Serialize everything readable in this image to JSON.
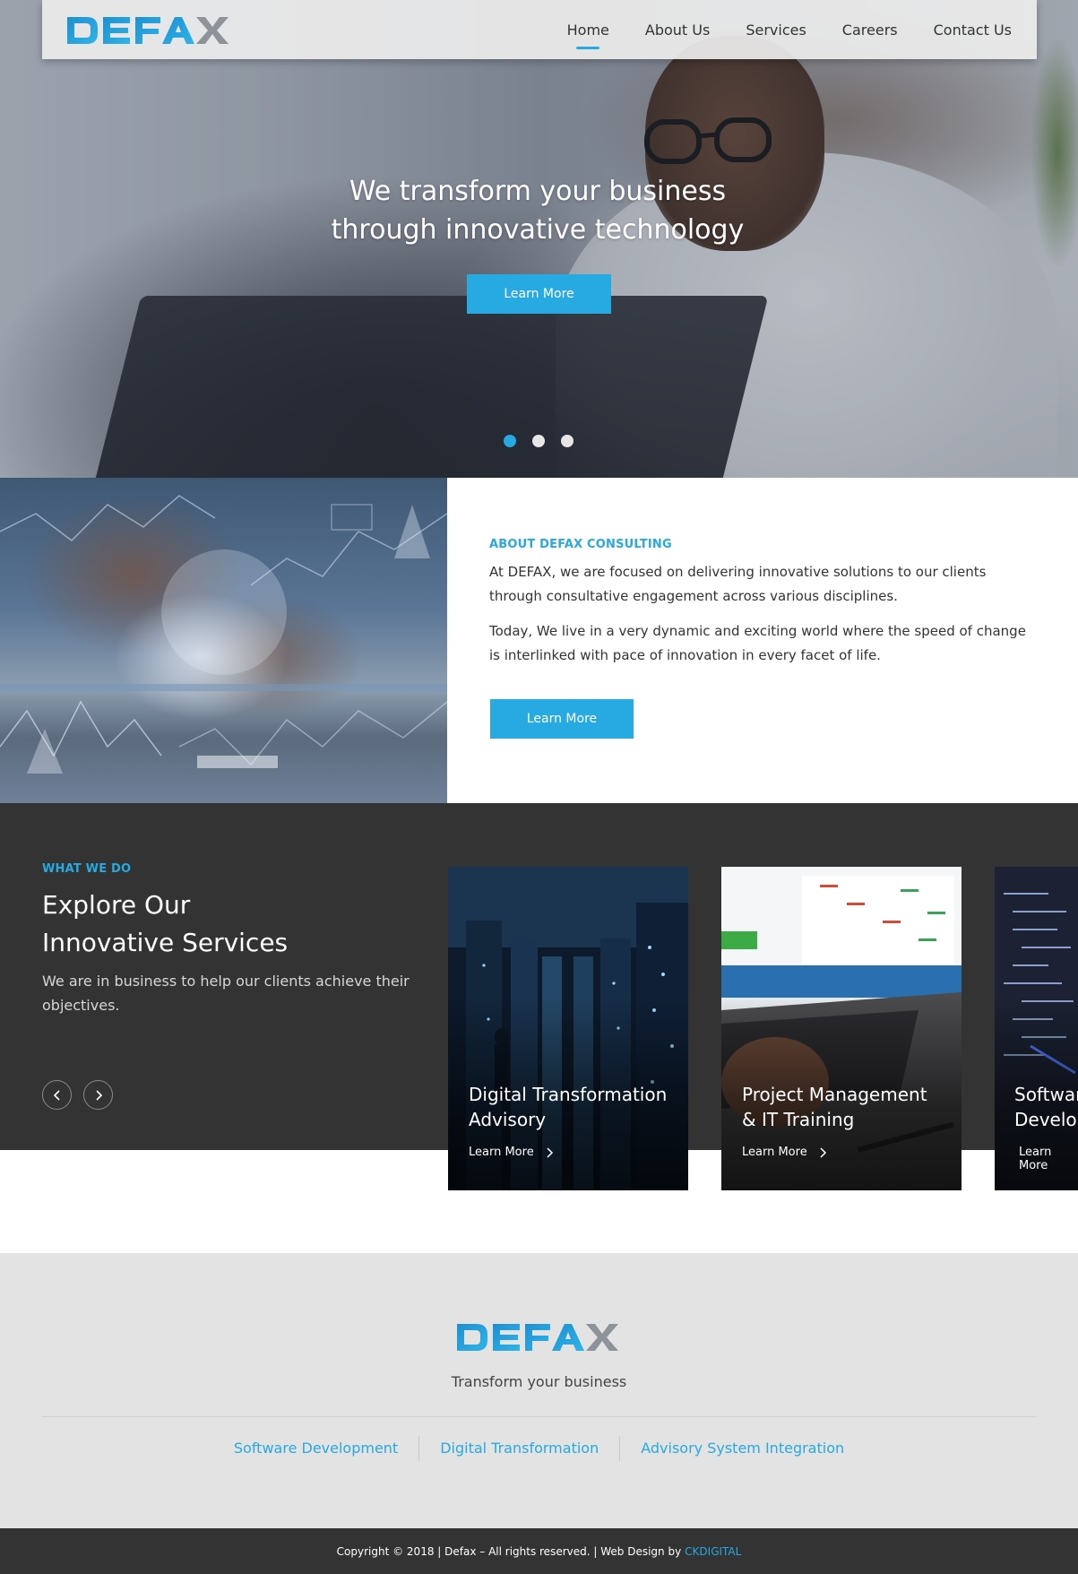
{
  "brand": {
    "name": "DEFAX",
    "accent_color": "#27a9e1",
    "dark_color": "#333333"
  },
  "nav": {
    "items": [
      {
        "label": "Home",
        "active": true
      },
      {
        "label": "About Us",
        "active": false
      },
      {
        "label": "Services",
        "active": false
      },
      {
        "label": "Careers",
        "active": false
      },
      {
        "label": "Contact Us",
        "active": false
      }
    ]
  },
  "hero": {
    "title_line1": "We transform your business",
    "title_line2": "through innovative technology",
    "button_label": "Learn More",
    "slides_total": 3,
    "active_slide": 1
  },
  "about": {
    "eyebrow": "ABOUT DEFAX CONSULTING",
    "paragraph1": "At DEFAX, we are focused on delivering innovative solutions to our clients through consultative engagement across various disciplines.",
    "paragraph2": "Today, We live in a very dynamic and exciting world where the speed of change is interlinked with pace of innovation in every facet of life.",
    "button_label": "Learn More"
  },
  "services": {
    "eyebrow": "WHAT WE DO",
    "title_line1": "Explore Our",
    "title_line2": "Innovative Services",
    "description": "We are in business to help our clients achieve their objectives.",
    "prev_icon": "chevron-left-icon",
    "next_icon": "chevron-right-icon",
    "cards": [
      {
        "title_line1": "Digital Transformation",
        "title_line2": "Advisory",
        "link_label": "Learn More"
      },
      {
        "title_line1": "Project Management",
        "title_line2": "& IT Training",
        "link_label": "Learn More"
      },
      {
        "title_line1": "Software",
        "title_line2": "Development",
        "link_label": "Learn More"
      }
    ]
  },
  "footer": {
    "tagline": "Transform your business",
    "links": [
      "Software Development",
      "Digital Transformation",
      "Advisory System Integration"
    ],
    "copyright_text": "Copyright © 2018 | Defax – All rights reserved. | Web Design by",
    "credit_link": "CKDIGITAL"
  }
}
